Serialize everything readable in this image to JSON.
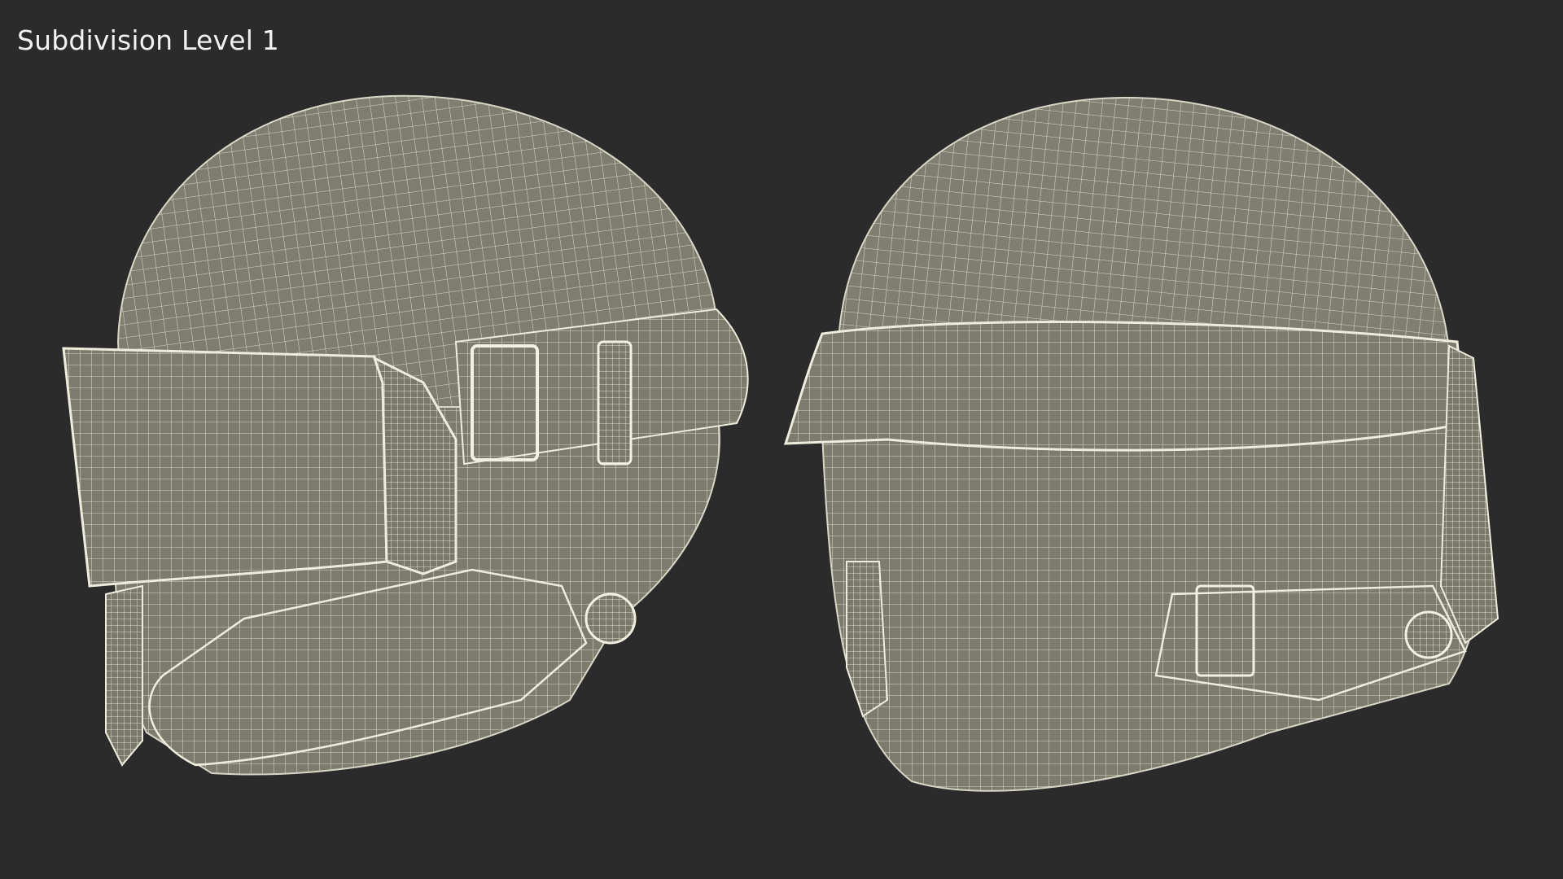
{
  "viewport": {
    "label": "Subdivision Level 1",
    "background_color": "#2b2b2b",
    "mesh_fill_color": "#7d7b6d",
    "wire_color": "#e6e4d4"
  },
  "models": [
    {
      "name": "helmet-three-quarter-view"
    },
    {
      "name": "helmet-front-view"
    }
  ]
}
